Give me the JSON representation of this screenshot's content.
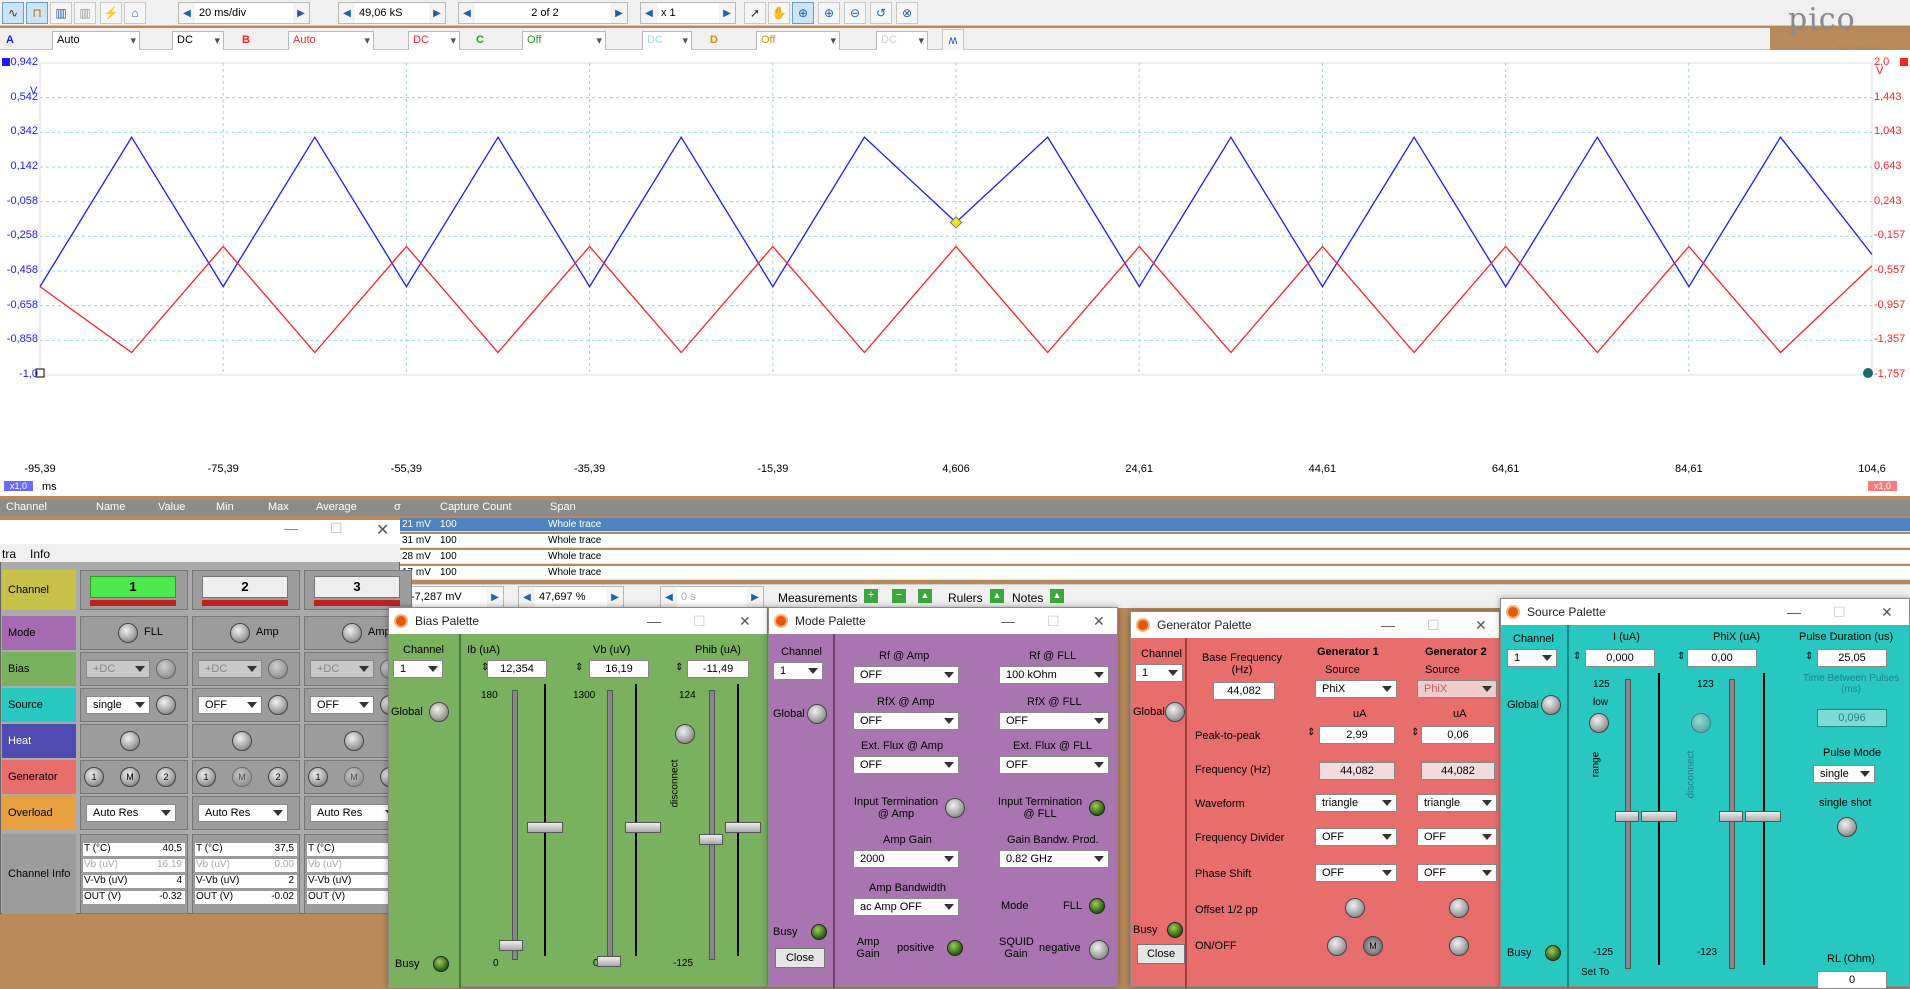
{
  "toolbar": {
    "timebase": "20 ms/div",
    "samples": "49,06 kS",
    "capture": "2 of 2",
    "zoom": "x 1"
  },
  "channels_bar": {
    "a": {
      "letter": "A",
      "range": "Auto",
      "coupling": "DC"
    },
    "b": {
      "letter": "B",
      "range": "Auto",
      "coupling": "DC"
    },
    "c": {
      "letter": "C",
      "range": "Off",
      "coupling": "DC"
    },
    "d": {
      "letter": "D",
      "range": "Off",
      "coupling": "DC"
    }
  },
  "logo": {
    "name": "pico",
    "sub": "Technology"
  },
  "scope": {
    "left_axis": [
      "0,942",
      "0,542",
      "0,342",
      "0,142",
      "-0,058",
      "-0,258",
      "-0,458",
      "-0,658",
      "-0,858",
      "-1,0"
    ],
    "left_unit": "V",
    "right_axis": [
      "2,0",
      "1,443",
      "1,043",
      "0,643",
      "0,243",
      "-0,157",
      "-0,557",
      "-0,957",
      "-1,357",
      "-1,757"
    ],
    "right_unit": "V",
    "x_axis": [
      "-95,39",
      "-75,39",
      "-55,39",
      "-35,39",
      "-15,39",
      "4,606",
      "24,61",
      "44,61",
      "64,61",
      "84,61",
      "104,6"
    ],
    "x_unit": "ms",
    "left_scale": "x1,0",
    "right_scale": "x1,0",
    "colors": {
      "a": "#1a1aff",
      "b": "#ff2020"
    }
  },
  "chart_data": {
    "type": "line",
    "x": [
      -95.39,
      -85.39,
      -75.39,
      -65.39,
      -55.39,
      -45.39,
      -35.39,
      -25.39,
      -15.39,
      -5.39,
      4.606,
      14.61,
      24.61,
      34.61,
      44.61,
      54.61,
      64.61,
      74.61,
      84.61,
      94.61,
      104.6
    ],
    "series": [
      {
        "name": "A",
        "values": [
          -0.45,
          0.48,
          -0.45,
          0.48,
          -0.45,
          0.48,
          -0.45,
          0.48,
          -0.45,
          0.48,
          -0.05,
          0.48,
          -0.45,
          0.48,
          -0.45,
          0.48,
          -0.45,
          0.48,
          -0.45,
          0.48,
          -0.25
        ]
      },
      {
        "name": "B",
        "values": [
          -0.45,
          -0.86,
          -0.2,
          -0.86,
          -0.2,
          -0.86,
          -0.2,
          -0.86,
          -0.2,
          -0.86,
          -0.2,
          -0.86,
          -0.2,
          -0.86,
          -0.2,
          -0.86,
          -0.2,
          -0.86,
          -0.2,
          -0.86,
          -0.32
        ]
      }
    ],
    "ylim": [
      -1.0,
      0.942
    ]
  },
  "meas": {
    "headers": [
      "Channel",
      "Name",
      "Value",
      "Min",
      "Max",
      "Average",
      "σ",
      "Capture Count",
      "Span"
    ],
    "rows": [
      {
        "v": "21 mV",
        "count": "100",
        "span": "Whole trace"
      },
      {
        "v": "31 mV",
        "count": "100",
        "span": "Whole trace"
      },
      {
        "v": "28 mV",
        "count": "100",
        "span": "Whole trace"
      },
      {
        "v": "17 mV",
        "count": "100",
        "span": "Whole trace"
      }
    ]
  },
  "status_bar": {
    "value1": "-7,287 mV",
    "value2": "47,697 %",
    "value3": "0 s",
    "measurements": "Measurements",
    "rulers": "Rulers",
    "notes": "Notes"
  },
  "chanwin": {
    "menu": [
      "tra",
      "Info"
    ],
    "rows": [
      "Channel",
      "Mode",
      "Bias",
      "Source",
      "Heat",
      "Generator",
      "Overload",
      "Channel Info"
    ],
    "cols": [
      {
        "n": "1",
        "mode": "FLL",
        "bias": "+DC",
        "src": "single",
        "ov": "Auto Res",
        "t": "40,5",
        "vb": "16.19",
        "vvb": "4",
        "out": "-0.32"
      },
      {
        "n": "2",
        "mode": "Amp",
        "bias": "+DC",
        "src": "OFF",
        "ov": "Auto Res",
        "t": "37,5",
        "vb": "0.00",
        "vvb": "2",
        "out": "-0.02"
      },
      {
        "n": "3",
        "mode": "Amp",
        "bias": "+DC",
        "src": "OFF",
        "ov": "Auto Res",
        "t": "",
        "vb": "",
        "vvb": "",
        "out": ""
      }
    ],
    "info_labels": {
      "t": "T (°C)",
      "vb": "Vb (uV)",
      "vvb": "V-Vb (uV)",
      "out": "OUT (V)"
    },
    "gen_labels": [
      "1",
      "M",
      "2"
    ]
  },
  "bias": {
    "title": "Bias Palette",
    "channel_lbl": "Channel",
    "channel": "1",
    "global": "Global",
    "busy": "Busy",
    "setto": "Set To",
    "ib": {
      "lbl": "Ib (uA)",
      "val": "12,354",
      "max": "180",
      "min": "0"
    },
    "vb": {
      "lbl": "Vb (uV)",
      "val": "16,19",
      "max": "1300",
      "min": "0"
    },
    "phib": {
      "lbl": "Phib (uA)",
      "val": "-11,49",
      "max": "124",
      "min": "-125",
      "disc": "disconnect"
    }
  },
  "mode": {
    "title": "Mode Palette",
    "channel_lbl": "Channel",
    "channel": "1",
    "global": "Global",
    "busy": "Busy",
    "close": "Close",
    "rf_amp": {
      "lbl": "Rf @ Amp",
      "val": "OFF"
    },
    "rfx_amp": {
      "lbl": "RfX @ Amp",
      "val": "OFF"
    },
    "ext_amp": {
      "lbl": "Ext. Flux @ Amp",
      "val": "OFF"
    },
    "inp_amp": "Input Termination @ Amp",
    "gain": {
      "lbl": "Amp Gain",
      "val": "2000"
    },
    "bw": {
      "lbl": "Amp Bandwidth",
      "val": "ac Amp OFF"
    },
    "ampgain": {
      "lbl": "Amp Gain",
      "val": "positive"
    },
    "rf_fll": {
      "lbl": "Rf @ FLL",
      "val": "100 kOhm"
    },
    "rfx_fll": {
      "lbl": "RfX @ FLL",
      "val": "OFF"
    },
    "ext_fll": {
      "lbl": "Ext. Flux @ FLL",
      "val": "OFF"
    },
    "inp_fll": "Input Termination @ FLL",
    "gbp": {
      "lbl": "Gain Bandw. Prod.",
      "val": "0.82 GHz"
    },
    "modelbl": "Mode",
    "modeval": "FLL",
    "squid": {
      "lbl": "SQUID Gain",
      "val": "negative"
    }
  },
  "gen": {
    "title": "Generator Palette",
    "channel_lbl": "Channel",
    "channel": "1",
    "global": "Global",
    "busy": "Busy",
    "close": "Close",
    "base_lbl": "Base Frequency (Hz)",
    "base": "44,082",
    "g1": "Generator 1",
    "g2": "Generator 2",
    "source": "Source",
    "s1": "PhiX",
    "s2": "PhiX",
    "ua": "uA",
    "rows": [
      "Peak-to-peak",
      "Frequency (Hz)",
      "Waveform",
      "Frequency Divider",
      "Phase Shift",
      "Offset 1/2 pp",
      "ON/OFF"
    ],
    "p1": "2,99",
    "p2": "0,06",
    "f1": "44,082",
    "f2": "44,082",
    "w1": "triangle",
    "w2": "triangle",
    "d1": "OFF",
    "d2": "OFF",
    "ph1": "OFF",
    "ph2": "OFF",
    "m": "M"
  },
  "src": {
    "title": "Source Palette",
    "channel_lbl": "Channel",
    "channel": "1",
    "global": "Global",
    "busy": "Busy",
    "setto": "Set To",
    "i": {
      "lbl": "I (uA)",
      "val": "0,000",
      "max": "125",
      "min": "-125",
      "low": "low",
      "range": "range"
    },
    "phix": {
      "lbl": "PhiX (uA)",
      "val": "0,00",
      "max": "123",
      "min": "-123",
      "disc": "disconnect"
    },
    "pd": {
      "lbl": "Pulse Duration (us)",
      "val": "25,05"
    },
    "tbp": {
      "lbl": "Time Between Pulses (ms)",
      "val": "0,096"
    },
    "pm": {
      "lbl": "Pulse Mode",
      "val": "single"
    },
    "ss": "single shot",
    "rl": {
      "lbl": "RL (Ohm)",
      "val": "0"
    }
  }
}
